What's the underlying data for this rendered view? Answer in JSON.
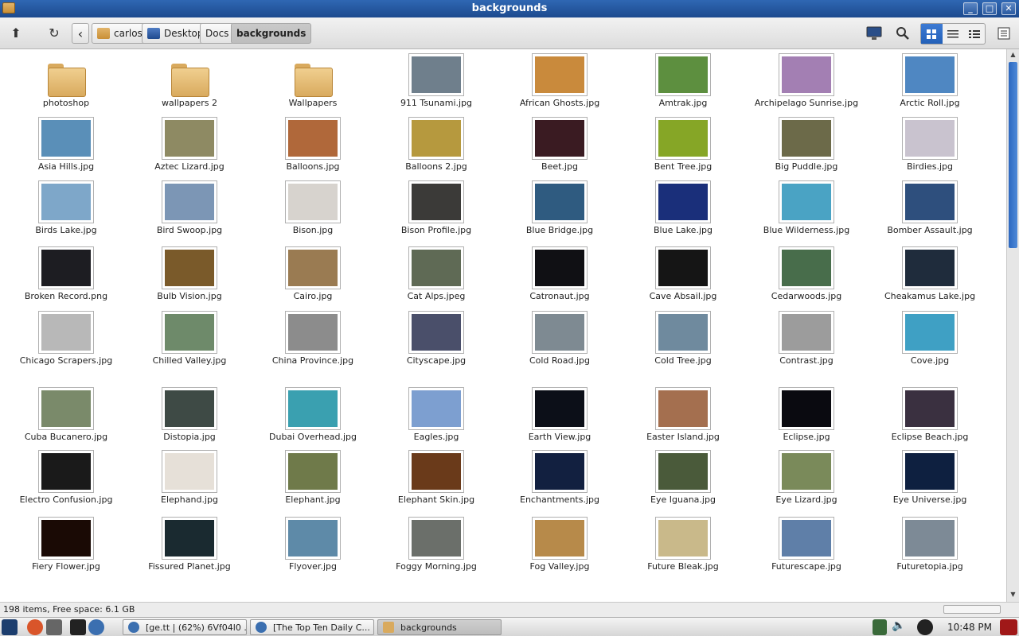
{
  "window": {
    "title": "backgrounds"
  },
  "window_buttons": {
    "minimize": "_",
    "maximize": "□",
    "close": "✕"
  },
  "toolbar": {
    "up_icon": "⬆",
    "reload_icon": "↻",
    "back_icon": "‹",
    "breadcrumbs": [
      "carlos",
      "Desktop",
      "Docs",
      "backgrounds"
    ]
  },
  "items": [
    {
      "name": "photoshop",
      "kind": "folder"
    },
    {
      "name": "wallpapers 2",
      "kind": "folder"
    },
    {
      "name": "Wallpapers",
      "kind": "folder"
    },
    {
      "name": "911 Tsunami.jpg",
      "color": "#6f7f8c"
    },
    {
      "name": "African Ghosts.jpg",
      "color": "#c98a3c"
    },
    {
      "name": "Amtrak.jpg",
      "color": "#5d8f3f"
    },
    {
      "name": "Archipelago Sunrise.jpg",
      "color": "#a37fb3"
    },
    {
      "name": "Arctic Roll.jpg",
      "color": "#4f87c2"
    },
    {
      "name": "Asia Hills.jpg",
      "color": "#5a8fb8"
    },
    {
      "name": "Aztec Lizard.jpg",
      "color": "#8e8a63"
    },
    {
      "name": "Balloons.jpg",
      "color": "#b0683a"
    },
    {
      "name": "Balloons 2.jpg",
      "color": "#b6993e"
    },
    {
      "name": "Beet.jpg",
      "color": "#3a1b22"
    },
    {
      "name": "Bent Tree.jpg",
      "color": "#86a626"
    },
    {
      "name": "Big Puddle.jpg",
      "color": "#6c6a49"
    },
    {
      "name": "Birdies.jpg",
      "color": "#c9c3cf"
    },
    {
      "name": "Birds Lake.jpg",
      "color": "#7ea7c9"
    },
    {
      "name": "Bird Swoop.jpg",
      "color": "#7c96b5"
    },
    {
      "name": "Bison.jpg",
      "color": "#d7d3ce"
    },
    {
      "name": "Bison Profile.jpg",
      "color": "#3b3a38"
    },
    {
      "name": "Blue Bridge.jpg",
      "color": "#2f5b80"
    },
    {
      "name": "Blue Lake.jpg",
      "color": "#1a2f7a"
    },
    {
      "name": "Blue Wilderness.jpg",
      "color": "#4aa3c4"
    },
    {
      "name": "Bomber Assault.jpg",
      "color": "#2e4f7d"
    },
    {
      "name": "Broken Record.png",
      "color": "#1d1d22"
    },
    {
      "name": "Bulb Vision.jpg",
      "color": "#7a5a2a"
    },
    {
      "name": "Cairo.jpg",
      "color": "#9a7b52"
    },
    {
      "name": "Cat Alps.jpeg",
      "color": "#5f6a55"
    },
    {
      "name": "Catronaut.jpg",
      "color": "#101014"
    },
    {
      "name": "Cave Absail.jpg",
      "color": "#151515"
    },
    {
      "name": "Cedarwoods.jpg",
      "color": "#486d4b"
    },
    {
      "name": "Cheakamus Lake.jpg",
      "color": "#1f2c3c"
    },
    {
      "name": "Chicago Scrapers.jpg",
      "color": "#b8b8b8"
    },
    {
      "name": "Chilled Valley.jpg",
      "color": "#6e8a6a"
    },
    {
      "name": "China Province.jpg",
      "color": "#8c8c8c"
    },
    {
      "name": "Cityscape.jpg",
      "color": "#4a4f6a"
    },
    {
      "name": "Cold Road.jpg",
      "color": "#7e8a92"
    },
    {
      "name": "Cold Tree.jpg",
      "color": "#6f8a9e"
    },
    {
      "name": "Contrast.jpg",
      "color": "#9c9c9c"
    },
    {
      "name": "Cove.jpg",
      "color": "#3fa0c4"
    },
    {
      "name": "Cuba Bucanero.jpg",
      "color": "#7a8a6a"
    },
    {
      "name": "Distopia.jpg",
      "color": "#3e4a45"
    },
    {
      "name": "Dubai Overhead.jpg",
      "color": "#3aa0b0"
    },
    {
      "name": "Eagles.jpg",
      "color": "#7d9fd0"
    },
    {
      "name": "Earth View.jpg",
      "color": "#0c0f18"
    },
    {
      "name": "Easter Island.jpg",
      "color": "#a46f4f"
    },
    {
      "name": "Eclipse.jpg",
      "color": "#0a0a10"
    },
    {
      "name": "Eclipse Beach.jpg",
      "color": "#3a3040"
    },
    {
      "name": "Electro Confusion.jpg",
      "color": "#1a1a1a"
    },
    {
      "name": "Elephand.jpg",
      "color": "#e6e0d8"
    },
    {
      "name": "Elephant.jpg",
      "color": "#6f7a4a"
    },
    {
      "name": "Elephant Skin.jpg",
      "color": "#6a3a1a"
    },
    {
      "name": "Enchantments.jpg",
      "color": "#122040"
    },
    {
      "name": "Eye Iguana.jpg",
      "color": "#4a5a3a"
    },
    {
      "name": "Eye Lizard.jpg",
      "color": "#7a8a5a"
    },
    {
      "name": "Eye Universe.jpg",
      "color": "#0e2040"
    },
    {
      "name": "Fiery Flower.jpg",
      "color": "#1a0a05"
    },
    {
      "name": "Fissured Planet.jpg",
      "color": "#1a2a30"
    },
    {
      "name": "Flyover.jpg",
      "color": "#5e8aa8"
    },
    {
      "name": "Foggy Morning.jpg",
      "color": "#6b6f6a"
    },
    {
      "name": "Fog Valley.jpg",
      "color": "#b78a4a"
    },
    {
      "name": "Future Bleak.jpg",
      "color": "#c9b98a"
    },
    {
      "name": "Futurescape.jpg",
      "color": "#5f7fa8"
    },
    {
      "name": "Futuretopia.jpg",
      "color": "#7d8a96"
    }
  ],
  "status": {
    "text": "198 items, Free space: 6.1 GB"
  },
  "taskbar": {
    "tasks": [
      "[ge.tt | (62%) 6Vf04l0 ...",
      "[The Top Ten Daily C...",
      "backgrounds"
    ],
    "clock": "10:48 PM"
  }
}
